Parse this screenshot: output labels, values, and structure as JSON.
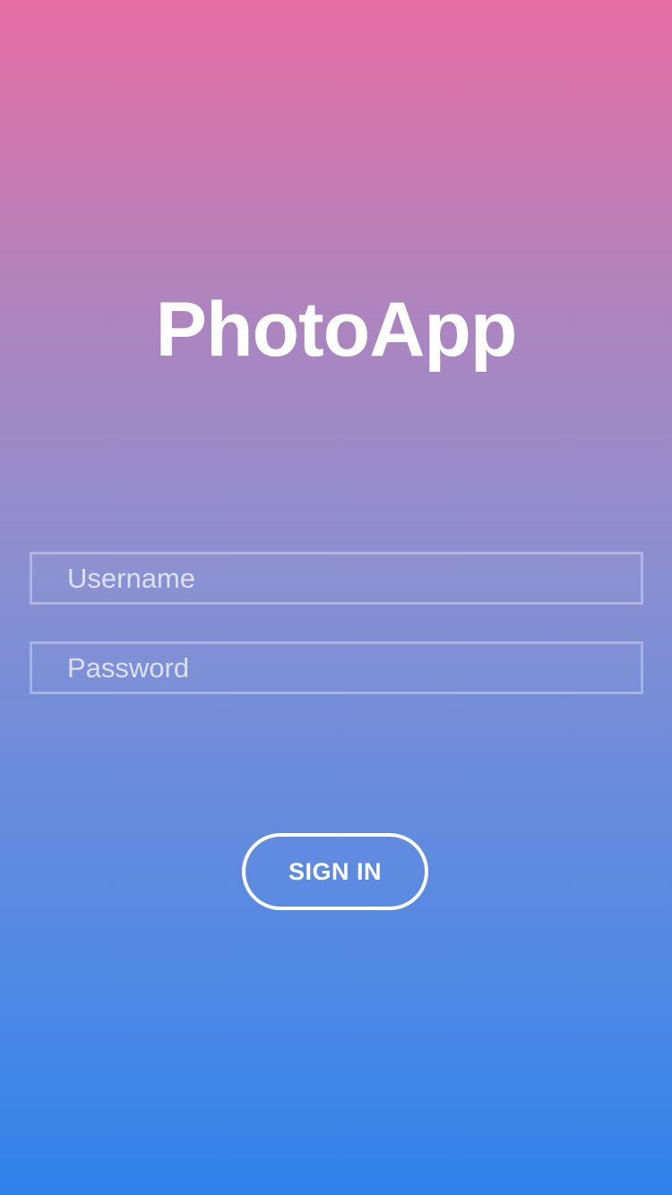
{
  "app": {
    "title": "PhotoApp"
  },
  "form": {
    "username": {
      "placeholder": "Username",
      "value": ""
    },
    "password": {
      "placeholder": "Password",
      "value": ""
    },
    "sign_in_label": "SIGN IN"
  },
  "colors": {
    "gradient_top": "#e76ea4",
    "gradient_bottom": "#2e82ea",
    "text": "#ffffff"
  }
}
